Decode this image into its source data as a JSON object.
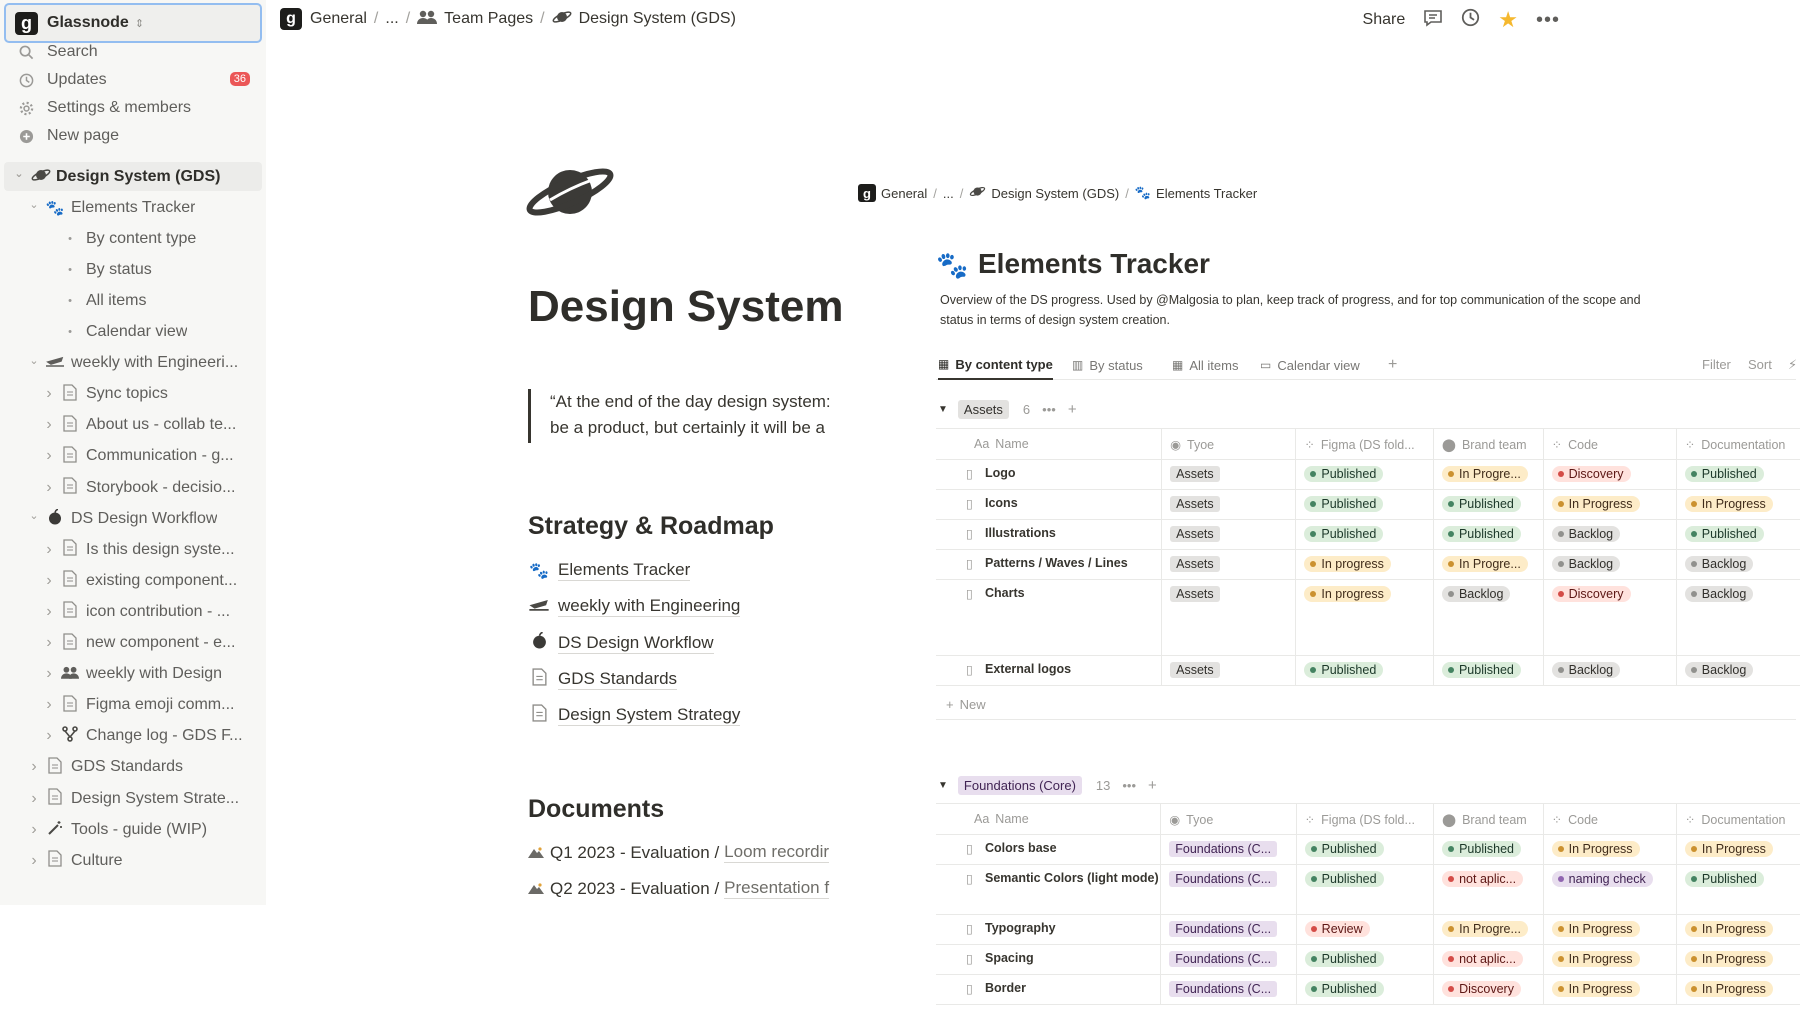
{
  "workspace": {
    "name": "Glassnode",
    "logo_letter": "g"
  },
  "sidebar": {
    "top_items": [
      {
        "label": "Search",
        "icon": "search-icon"
      },
      {
        "label": "Updates",
        "icon": "clock-icon",
        "badge": "36"
      },
      {
        "label": "Settings & members",
        "icon": "gear-icon"
      },
      {
        "label": "New page",
        "icon": "plus-circle-icon"
      }
    ],
    "tree": [
      {
        "label": "Design System (GDS)",
        "icon": "planet-icon",
        "level": 0,
        "chevron": "down",
        "active": true
      },
      {
        "label": "Elements Tracker",
        "icon": "paw-icon",
        "level": 1,
        "chevron": "down"
      },
      {
        "label": "By content type",
        "icon": "bullet",
        "level": 2
      },
      {
        "label": "By status",
        "icon": "bullet",
        "level": 2
      },
      {
        "label": "All items",
        "icon": "bullet",
        "level": 2
      },
      {
        "label": "Calendar view",
        "icon": "bullet",
        "level": 2
      },
      {
        "label": "weekly with Engineeri...",
        "icon": "plane-icon",
        "level": 1,
        "chevron": "down"
      },
      {
        "label": "Sync topics",
        "icon": "page-icon",
        "level": 2,
        "chevron": "right"
      },
      {
        "label": "About us - collab te...",
        "icon": "page-icon",
        "level": 2,
        "chevron": "right"
      },
      {
        "label": "Communication - g...",
        "icon": "page-icon",
        "level": 2,
        "chevron": "right"
      },
      {
        "label": "Storybook - decisio...",
        "icon": "page-icon",
        "level": 2,
        "chevron": "right"
      },
      {
        "label": "DS Design Workflow",
        "icon": "apple-icon",
        "level": 1,
        "chevron": "down"
      },
      {
        "label": "Is this design syste...",
        "icon": "page-icon",
        "level": 2,
        "chevron": "right"
      },
      {
        "label": "existing component...",
        "icon": "page-icon",
        "level": 2,
        "chevron": "right"
      },
      {
        "label": "icon contribution - ...",
        "icon": "page-icon",
        "level": 2,
        "chevron": "right"
      },
      {
        "label": "new component - e...",
        "icon": "page-icon",
        "level": 2,
        "chevron": "right"
      },
      {
        "label": "weekly with Design",
        "icon": "people-icon",
        "level": 2,
        "chevron": "right"
      },
      {
        "label": "Figma emoji comm...",
        "icon": "page-icon",
        "level": 2,
        "chevron": "right"
      },
      {
        "label": "Change log - GDS F...",
        "icon": "git-icon",
        "level": 2,
        "chevron": "right"
      },
      {
        "label": "GDS Standards",
        "icon": "page-icon",
        "level": 1,
        "chevron": "right"
      },
      {
        "label": "Design System Strate...",
        "icon": "page-icon",
        "level": 1,
        "chevron": "right"
      },
      {
        "label": "Tools - guide (WIP)",
        "icon": "wand-icon",
        "level": 1,
        "chevron": "right"
      },
      {
        "label": "Culture",
        "icon": "page-icon",
        "level": 1,
        "chevron": "right"
      }
    ]
  },
  "topbar": {
    "crumbs": [
      "General",
      "...",
      "Team Pages",
      "Design System (GDS)"
    ],
    "share_label": "Share"
  },
  "page": {
    "title": "Design System",
    "quote_line1": "“At the end of the day design system:",
    "quote_line2": "be a product, but certainly it will be a",
    "section1": "Strategy & Roadmap",
    "links": [
      {
        "label": "Elements Tracker",
        "icon": "paw-icon"
      },
      {
        "label": "weekly with Engineering",
        "icon": "plane-icon"
      },
      {
        "label": "DS Design Workflow",
        "icon": "apple-icon"
      },
      {
        "label": "GDS Standards",
        "icon": "page-icon"
      },
      {
        "label": "Design System Strategy",
        "icon": "page-icon"
      }
    ],
    "section2": "Documents",
    "documents": [
      {
        "label": "Q1 2023 - Evaluation /",
        "suffix": "Loom recordir"
      },
      {
        "label": "Q2 2023 - Evaluation /",
        "suffix": "Presentation f"
      }
    ]
  },
  "panel": {
    "crumbs": [
      "General",
      "...",
      "Design System (GDS)",
      "Elements Tracker"
    ],
    "title": "Elements Tracker",
    "description": "Overview of the DS progress. Used by @Malgosia to plan, keep track of progress, and for top communication of the scope and status in terms of design system creation.",
    "views": [
      "By content type",
      "By status",
      "All items",
      "Calendar view"
    ],
    "filter_label": "Filter",
    "sort_label": "Sort",
    "columns": [
      "Name",
      "Tyoe",
      "Figma (DS fold...",
      "Brand team",
      "Code",
      "Documentation"
    ],
    "new_label": "New",
    "groups": [
      {
        "name": "Assets",
        "count": "6",
        "rows": [
          {
            "name": "Logo",
            "type": "Assets",
            "figma": "Published",
            "brand": "In Progre...",
            "code": "Discovery",
            "doc": "Published"
          },
          {
            "name": "Icons",
            "type": "Assets",
            "figma": "Published",
            "brand": "Published",
            "code": "In Progress",
            "doc": "In Progress"
          },
          {
            "name": "Illustrations",
            "type": "Assets",
            "figma": "Published",
            "brand": "Published",
            "code": "Backlog",
            "doc": "Published"
          },
          {
            "name": "Patterns / Waves / Lines",
            "type": "Assets",
            "figma": "In progress",
            "brand": "In Progre...",
            "code": "Backlog",
            "doc": "Backlog"
          },
          {
            "name": "Charts",
            "type": "Assets",
            "figma": "In progress",
            "brand": "Backlog",
            "code": "Discovery",
            "doc": "Backlog"
          },
          {
            "name": "External logos",
            "type": "Assets",
            "figma": "Published",
            "brand": "Published",
            "code": "Backlog",
            "doc": "Backlog"
          }
        ]
      },
      {
        "name": "Foundations (Core)",
        "count": "13",
        "rows": [
          {
            "name": "Colors base",
            "type": "Foundations (C...",
            "figma": "Published",
            "brand": "Published",
            "code": "In Progress",
            "doc": "In Progress"
          },
          {
            "name": "Semantic Colors (light mode)",
            "type": "Foundations (C...",
            "figma": "Published",
            "brand": "not aplic...",
            "code": "naming check",
            "doc": "Published"
          },
          {
            "name": "Typography",
            "type": "Foundations (C...",
            "figma": "Review",
            "brand": "In Progre...",
            "code": "In Progress",
            "doc": "In Progress"
          },
          {
            "name": "Spacing",
            "type": "Foundations (C...",
            "figma": "Published",
            "brand": "not aplic...",
            "code": "In Progress",
            "doc": "In Progress"
          },
          {
            "name": "Border",
            "type": "Foundations (C...",
            "figma": "Published",
            "brand": "Discovery",
            "code": "In Progress",
            "doc": "In Progress"
          }
        ]
      }
    ]
  },
  "colors": {
    "accent_star": "#f5b82e",
    "badge": "#eb5757",
    "focus_ring": "#93bdf0"
  }
}
